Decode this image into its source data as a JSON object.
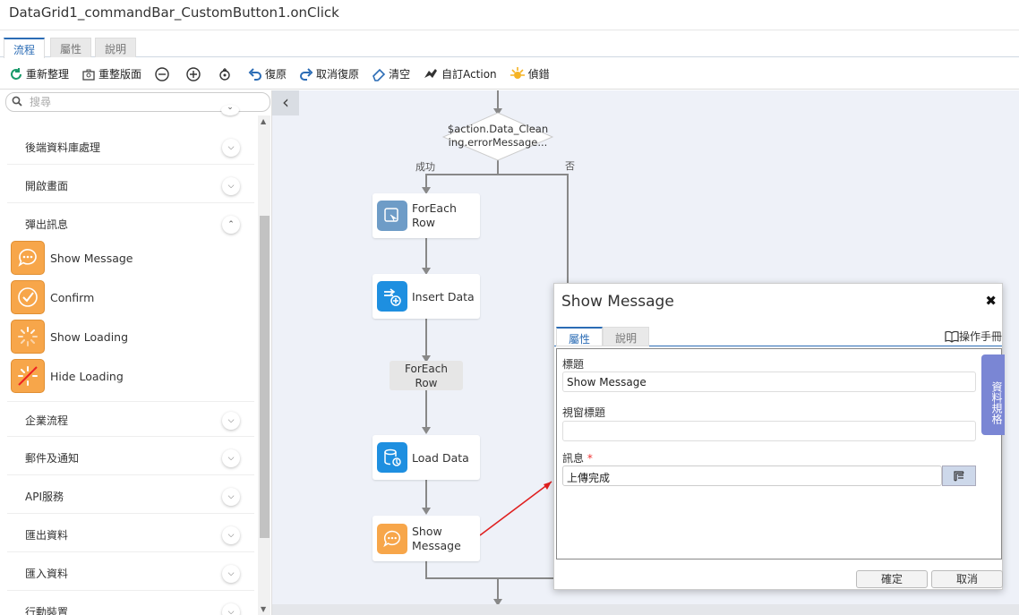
{
  "window": {
    "title": "DataGrid1_commandBar_CustomButton1.onClick"
  },
  "top_tabs": [
    {
      "label": "流程"
    },
    {
      "label": "屬性"
    },
    {
      "label": "說明"
    }
  ],
  "toolbar": [
    {
      "label": "重新整理",
      "icon": "refresh-icon"
    },
    {
      "label": "重整版面",
      "icon": "layout-icon"
    },
    {
      "label": "",
      "icon": "zoom-out-icon"
    },
    {
      "label": "",
      "icon": "zoom-in-icon"
    },
    {
      "label": "",
      "icon": "fit-icon"
    },
    {
      "label": "復原",
      "icon": "undo-icon"
    },
    {
      "label": "取消復原",
      "icon": "redo-icon"
    },
    {
      "label": "清空",
      "icon": "eraser-icon"
    },
    {
      "label": "自訂Action",
      "icon": "custom-action-icon"
    },
    {
      "label": "偵錯",
      "icon": "debug-icon"
    }
  ],
  "sidebar": {
    "search_placeholder": "搜尋",
    "categories": [
      {
        "label": "後端資料庫處理"
      },
      {
        "label": "開啟畫面"
      },
      {
        "label": "彈出訊息"
      },
      {
        "label": "企業流程"
      },
      {
        "label": "郵件及通知"
      },
      {
        "label": "API服務"
      },
      {
        "label": "匯出資料"
      },
      {
        "label": "匯入資料"
      },
      {
        "label": "行動裝置"
      }
    ],
    "popup_items": [
      {
        "label": "Show Message",
        "icon": "message-bubble-icon"
      },
      {
        "label": "Confirm",
        "icon": "check-circle-icon"
      },
      {
        "label": "Show Loading",
        "icon": "spinner-icon"
      },
      {
        "label": "Hide Loading",
        "icon": "spinner-off-icon"
      }
    ]
  },
  "flow": {
    "decision": {
      "line1": "$action.Data_Clean",
      "line2": "ing.errorMessage..."
    },
    "edge_success": "成功",
    "edge_no": "否",
    "nodes": [
      {
        "line1": "ForEach",
        "line2": "Row"
      },
      {
        "line1": "Insert Data",
        "line2": ""
      },
      {
        "line1": "ForEach",
        "line2": "Row"
      },
      {
        "line1": "Load Data",
        "line2": ""
      },
      {
        "line1": "Show",
        "line2": "Message"
      }
    ]
  },
  "dialog": {
    "title": "Show Message",
    "tabs": [
      {
        "label": "屬性"
      },
      {
        "label": "說明"
      }
    ],
    "manual": "操作手冊",
    "side_tab": "資料規格",
    "fields": {
      "title_label": "標題",
      "title_value": "Show Message",
      "window_title_label": "視窗標題",
      "window_title_value": "",
      "message_label": "訊息",
      "message_required": "*",
      "message_value": "上傳完成"
    },
    "ok": "確定",
    "cancel": "取消"
  },
  "colors": {
    "accent": "#2b6cb5",
    "orange": "#f7a64a",
    "blue_node": "#1e8fe0",
    "canvas": "#eef1f8",
    "arrow": "#e02020"
  }
}
